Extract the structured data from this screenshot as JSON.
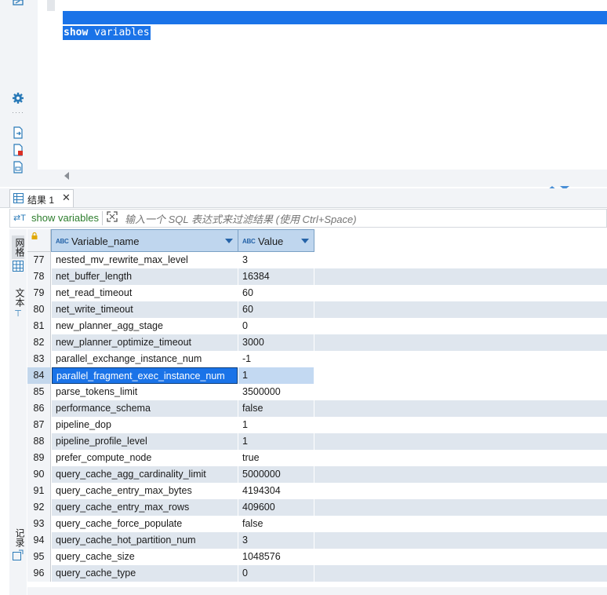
{
  "editor": {
    "sql_keyword": "show",
    "sql_rest": " variables"
  },
  "results": {
    "tab_label": "结果 1",
    "tab_close": "✕",
    "filter": {
      "query_label": "show variables",
      "placeholder": "输入一个 SQL 表达式来过滤结果 (使用 Ctrl+Space)"
    },
    "side_tabs": {
      "grid": "网格",
      "text": "文本",
      "record": "记录"
    },
    "columns": [
      {
        "type_badge": "ABC",
        "label": "Variable_name"
      },
      {
        "type_badge": "ABC",
        "label": "Value"
      }
    ],
    "selected_row": 84,
    "rows": [
      {
        "n": "77",
        "name": "nested_mv_rewrite_max_level",
        "value": "3"
      },
      {
        "n": "78",
        "name": "net_buffer_length",
        "value": "16384"
      },
      {
        "n": "79",
        "name": "net_read_timeout",
        "value": "60"
      },
      {
        "n": "80",
        "name": "net_write_timeout",
        "value": "60"
      },
      {
        "n": "81",
        "name": "new_planner_agg_stage",
        "value": "0"
      },
      {
        "n": "82",
        "name": "new_planner_optimize_timeout",
        "value": "3000"
      },
      {
        "n": "83",
        "name": "parallel_exchange_instance_num",
        "value": "-1"
      },
      {
        "n": "84",
        "name": "parallel_fragment_exec_instance_num",
        "value": "1"
      },
      {
        "n": "85",
        "name": "parse_tokens_limit",
        "value": "3500000"
      },
      {
        "n": "86",
        "name": "performance_schema",
        "value": "false"
      },
      {
        "n": "87",
        "name": "pipeline_dop",
        "value": "1"
      },
      {
        "n": "88",
        "name": "pipeline_profile_level",
        "value": "1"
      },
      {
        "n": "89",
        "name": "prefer_compute_node",
        "value": "true"
      },
      {
        "n": "90",
        "name": "query_cache_agg_cardinality_limit",
        "value": "5000000"
      },
      {
        "n": "91",
        "name": "query_cache_entry_max_bytes",
        "value": "4194304"
      },
      {
        "n": "92",
        "name": "query_cache_entry_max_rows",
        "value": "409600"
      },
      {
        "n": "93",
        "name": "query_cache_force_populate",
        "value": "false"
      },
      {
        "n": "94",
        "name": "query_cache_hot_partition_num",
        "value": "3"
      },
      {
        "n": "95",
        "name": "query_cache_size",
        "value": "1048576"
      },
      {
        "n": "96",
        "name": "query_cache_type",
        "value": "0"
      }
    ]
  }
}
